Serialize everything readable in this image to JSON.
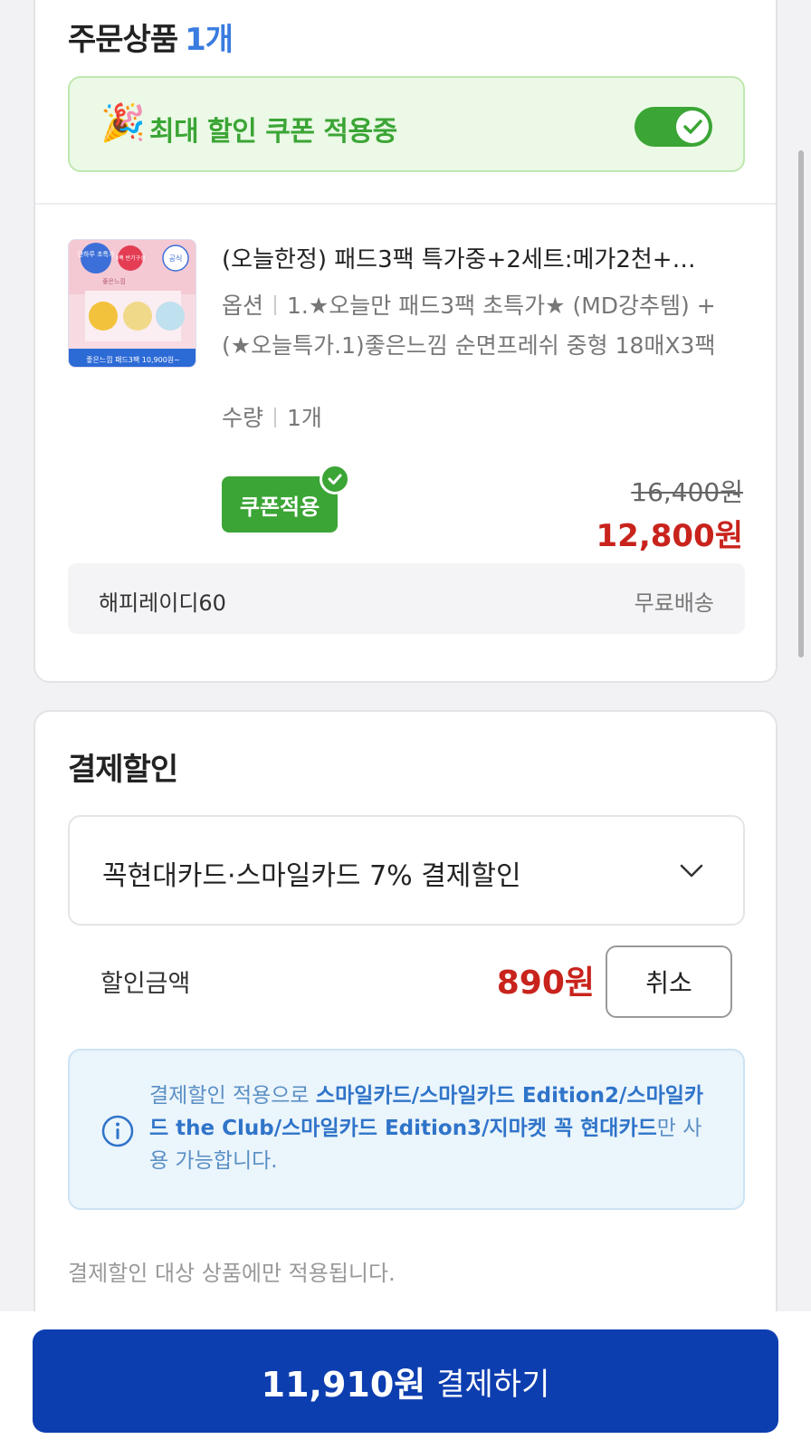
{
  "order": {
    "title": "주문상품",
    "count": "1개",
    "coupon_banner": {
      "icon": "party-popper-icon",
      "text": "최대 할인 쿠폰 적용중",
      "toggle_on": true
    },
    "item": {
      "name": "(오늘한정) 패드3팩 특가중+2세트:메가2천+…",
      "option_label": "옵션",
      "option_value": "1.★오늘만 패드3팩 초특가★ (MD강추템) + (★오늘특가.1)좋은느낌 순면프레쉬 중형 18매X3팩",
      "qty_label": "수량",
      "qty_value": "1개",
      "coupon_button": "쿠폰적용",
      "price_original": "16,400원",
      "price_final": "12,800원",
      "thumb": {
        "badge_left": "단하루 초특가",
        "badge_mid": "3팩 반기구성",
        "badge_right": "공식",
        "brand": "좋은느낌",
        "promo": "좋은느낌 패드3팩 10,900원~"
      }
    },
    "shipping": {
      "seller": "해피레이디60",
      "fee": "무료배송"
    }
  },
  "payment_discount": {
    "title": "결제할인",
    "selected": "꼭현대카드·스마일카드 7% 결제할인",
    "discount_label": "할인금액",
    "discount_amount": "890원",
    "cancel_label": "취소",
    "info_prefix": "결제할인 적용으로 ",
    "info_cards": "스마일카드/스마일카드 Edition2/스마일카드 the Club/스마일카드 Edition3/지마켓 꼭 현대카드",
    "info_suffix": "만 사용 가능합니다.",
    "note": "결제할인 대상 상품에만 적용됩니다."
  },
  "checkout": {
    "amount": "11,910원",
    "label": "결제하기"
  },
  "colors": {
    "green": "#3ba535",
    "red": "#c8231c",
    "blue": "#0d3eb0",
    "link_blue": "#3a7cdf"
  }
}
